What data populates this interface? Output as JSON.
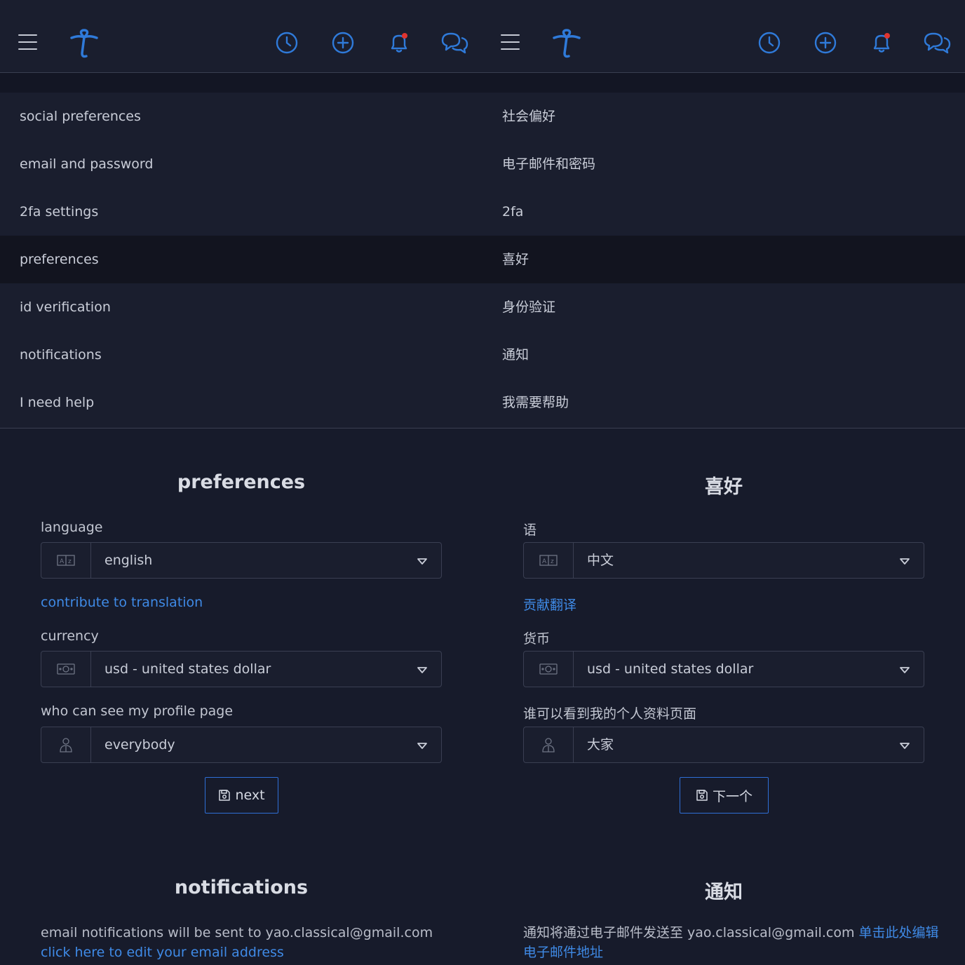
{
  "colors": {
    "accent": "#2f7ad9",
    "notification_dot": "#e0342f",
    "link": "#3f8ae6"
  },
  "icons": {
    "header": [
      "hamburger-menu-icon",
      "logo-icon",
      "history-clock-icon",
      "add-circle-icon",
      "bell-icon",
      "chat-bubbles-icon"
    ],
    "language_addon": "translate-icon",
    "currency_addon": "money-icon",
    "visibility_addon": "user-icon",
    "next_button": "save-icon"
  },
  "panels": [
    {
      "menu": [
        "social preferences",
        "email and password",
        "2fa settings",
        "preferences",
        "id verification",
        "notifications",
        "I need help"
      ],
      "active_index": 3,
      "preferences_title": "preferences",
      "language_label": "language",
      "language_value": "english",
      "translation_link": "contribute to translation",
      "currency_label": "currency",
      "currency_value": "usd - united states dollar",
      "visibility_label": "who can see my profile page",
      "visibility_value": "everybody",
      "next_label": "next",
      "notifications_title": "notifications",
      "notif_text": "email notifications will be sent to yao.classical@gmail.com ",
      "notif_link": "click here to edit your email address"
    },
    {
      "menu": [
        "社会偏好",
        "电子邮件和密码",
        "2fa",
        "喜好",
        "身份验证",
        "通知",
        "我需要帮助"
      ],
      "active_index": 3,
      "preferences_title": "喜好",
      "language_label": "语",
      "language_value": "中文",
      "translation_link": "贡献翻译",
      "currency_label": "货币",
      "currency_value": "usd - united states dollar",
      "visibility_label": "谁可以看到我的个人资料页面",
      "visibility_value": "大家",
      "next_label": "下一个",
      "notifications_title": "通知",
      "notif_text": "通知将通过电子邮件发送至 yao.classical@gmail.com ",
      "notif_link": "单击此处编辑电子邮件地址"
    }
  ]
}
